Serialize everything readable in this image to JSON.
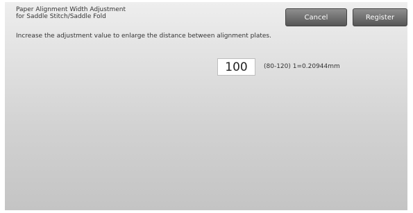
{
  "header": {
    "title_line1": "Paper Alignment Width Adjustment",
    "title_line2": "for Saddle Stitch/Saddle Fold",
    "cancel_label": "Cancel",
    "register_label": "Register"
  },
  "main": {
    "instruction": "Increase the adjustment value to enlarge the distance between alignment plates.",
    "value": "100",
    "range_note": "(80-120) 1=0.20944mm"
  }
}
